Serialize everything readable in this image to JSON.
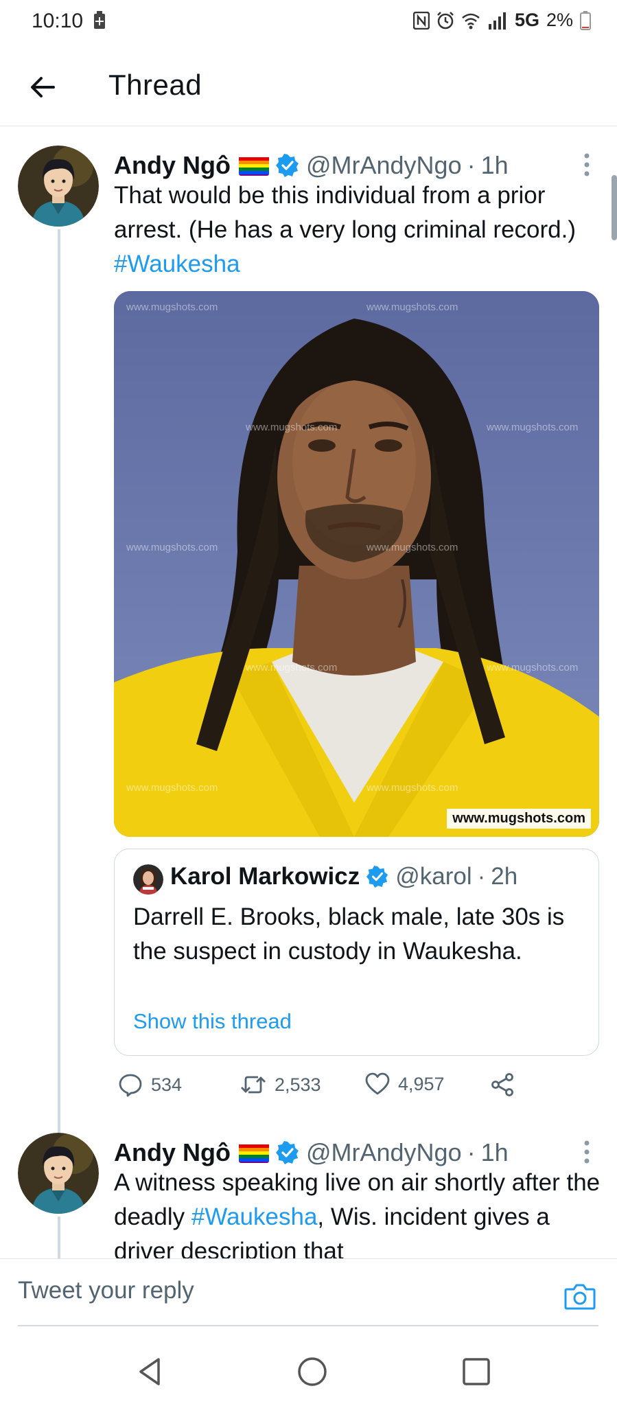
{
  "status_bar": {
    "time": "10:10",
    "network": "5G",
    "battery": "2%"
  },
  "header": {
    "title": "Thread"
  },
  "tweets": [
    {
      "name": "Andy Ngô",
      "handle": "@MrAndyNgo",
      "time": "1h",
      "text_before": "That would be this individual from a prior arrest. (He has a very long criminal record.) ",
      "hashtag": "#Waukesha",
      "media": {
        "watermark": "www.mugshots.com",
        "caption": "www.mugshots.com"
      },
      "quote": {
        "name": "Karol Markowicz",
        "handle": "@karol",
        "time": "2h",
        "text": "Darrell E. Brooks, black male, late 30s is the suspect in custody in Waukesha.",
        "link": "Show this thread"
      },
      "stats": {
        "replies": "534",
        "retweets": "2,533",
        "likes": "4,957"
      }
    },
    {
      "name": "Andy Ngô",
      "handle": "@MrAndyNgo",
      "time": "1h",
      "text_before": "A witness speaking live on air shortly after the deadly ",
      "hashtag": "#Waukesha",
      "text_after": ", Wis. incident gives a driver description that"
    }
  ],
  "reply": {
    "placeholder": "Tweet your reply"
  },
  "colors": {
    "accent": "#1d9bf0",
    "secondary_text": "#536471",
    "border": "#cfd9de"
  },
  "icons": [
    "back-arrow-icon",
    "verified-icon",
    "pride-flag-icon",
    "more-icon",
    "reply-icon",
    "retweet-icon",
    "like-icon",
    "share-icon",
    "camera-icon",
    "nav-back-icon",
    "nav-home-icon",
    "nav-recents-icon"
  ]
}
